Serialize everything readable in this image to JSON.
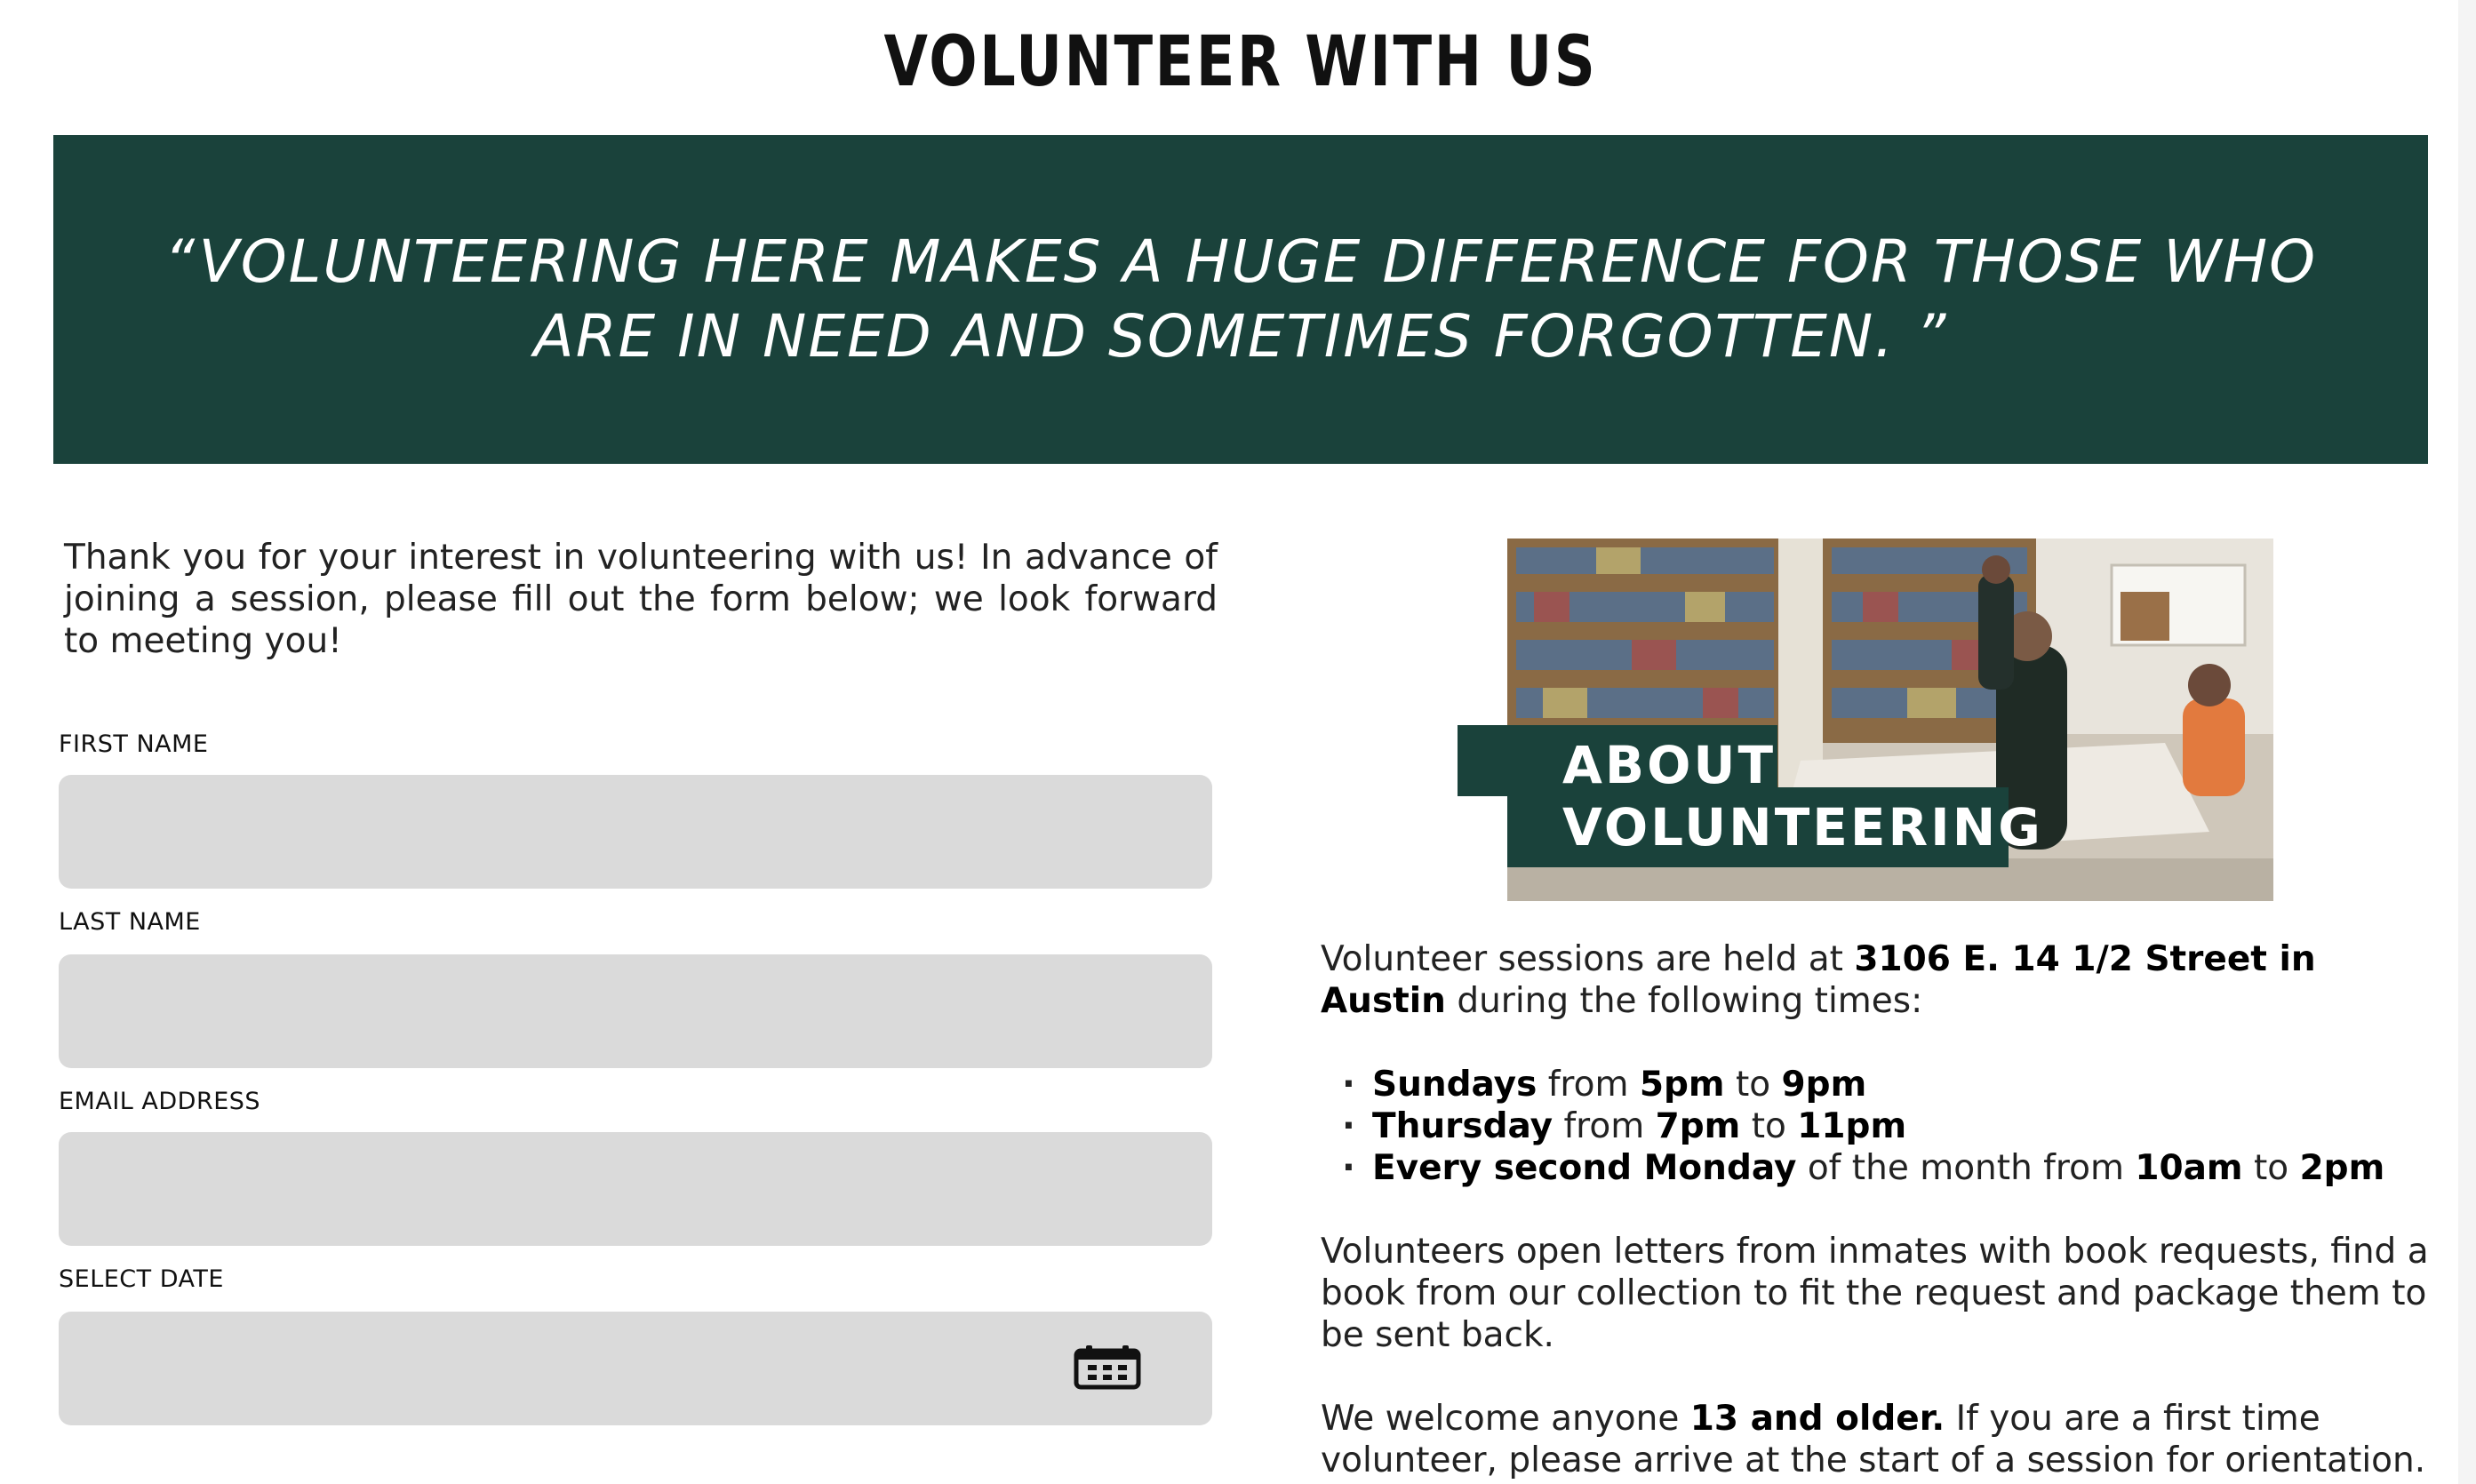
{
  "page": {
    "title": "VOLUNTEER WITH US"
  },
  "banner": {
    "quote": "“VOLUNTEERING HERE MAKES A HUGE DIFFERENCE FOR THOSE WHO ARE IN NEED AND SOMETIMES FORGOTTEN. ”"
  },
  "intro": {
    "text": "Thank you for your interest in volunteering with us! In advance of joining a session, please fill out the form below; we look forward to meeting you!"
  },
  "form": {
    "fields": [
      {
        "label": "FIRST NAME",
        "value": "",
        "placeholder": ""
      },
      {
        "label": "LAST NAME",
        "value": "",
        "placeholder": ""
      },
      {
        "label": "EMAIL ADDRESS",
        "value": "",
        "placeholder": ""
      },
      {
        "label": "SELECT DATE",
        "value": "",
        "placeholder": ""
      }
    ],
    "date_icon": "calendar-icon"
  },
  "about": {
    "label_line1": "ABOUT",
    "label_line2": "VOLUNTEERING"
  },
  "info": {
    "p1_pre": "Volunteer sessions are held at ",
    "p1_address": "3106 E. 14 1/2 Street in Austin",
    "p1_post": " during the following times:",
    "schedule": [
      {
        "day": "Sundays",
        "from_text": " from ",
        "start": "5pm",
        "to_text": " to ",
        "end": "9pm"
      },
      {
        "day": "Thursday",
        "from_text": " from ",
        "start": "7pm",
        "to_text": " to ",
        "end": "11pm"
      },
      {
        "day": "Every second Monday",
        "from_text": " of the month from ",
        "start": "10am",
        "to_text": " to ",
        "end": "2pm"
      }
    ],
    "p2": "Volunteers open letters from inmates with book requests, find a book from our collection to fit the request and package them to be sent back.",
    "p3_pre": "We welcome anyone ",
    "p3_bold": "13 and older.",
    "p3_post": " If you are a first time volunteer, please arrive at the start of a session for orientation."
  },
  "colors": {
    "brand_green": "#1a423b",
    "input_bg": "#dadada"
  }
}
